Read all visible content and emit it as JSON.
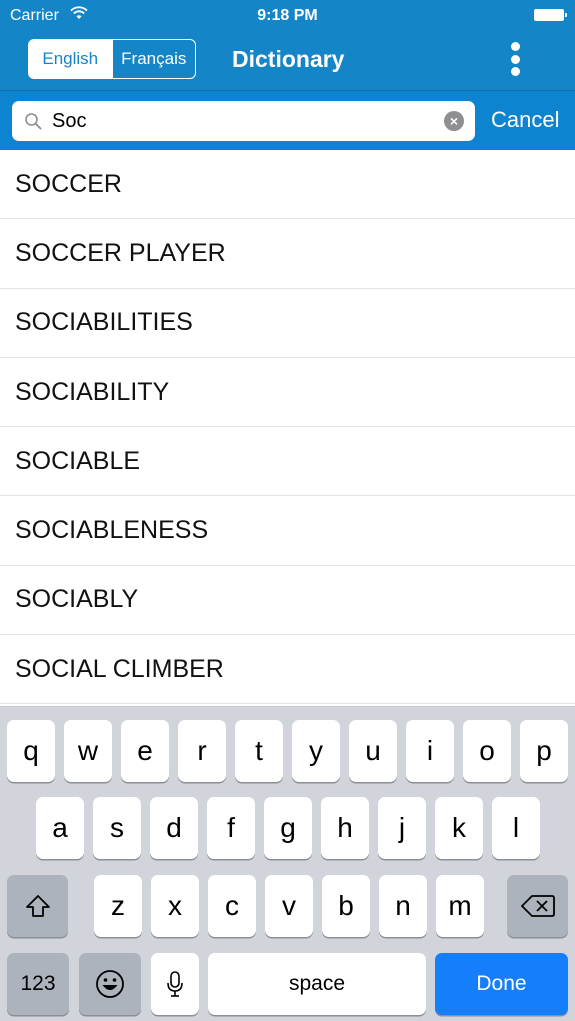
{
  "status_bar": {
    "carrier": "Carrier",
    "time": "9:18 PM"
  },
  "nav": {
    "segments": [
      {
        "label": "English",
        "selected": true
      },
      {
        "label": "Français",
        "selected": false
      }
    ],
    "title": "Dictionary",
    "menu_icon": "more-vertical-icon"
  },
  "search": {
    "value": "Soc",
    "placeholder": "",
    "cancel_label": "Cancel",
    "search_icon": "search-icon",
    "clear_icon": "clear-icon"
  },
  "results": [
    "SOCCER",
    "SOCCER PLAYER",
    "SOCIABILITIES",
    "SOCIABILITY",
    "SOCIABLE",
    "SOCIABLENESS",
    "SOCIABLY",
    "SOCIAL CLIMBER"
  ],
  "keyboard": {
    "row1": [
      "q",
      "w",
      "e",
      "r",
      "t",
      "y",
      "u",
      "i",
      "o",
      "p"
    ],
    "row2": [
      "a",
      "s",
      "d",
      "f",
      "g",
      "h",
      "j",
      "k",
      "l"
    ],
    "row3": [
      "z",
      "x",
      "c",
      "v",
      "b",
      "n",
      "m"
    ],
    "numbers_label": "123",
    "space_label": "space",
    "done_label": "Done",
    "shift_icon": "shift-icon",
    "backspace_icon": "backspace-icon",
    "emoji_icon": "emoji-icon",
    "mic_icon": "microphone-icon",
    "done_color": "#157efb"
  },
  "colors": {
    "nav_bg": "#1485c6",
    "search_bg": "#0d84cf"
  }
}
